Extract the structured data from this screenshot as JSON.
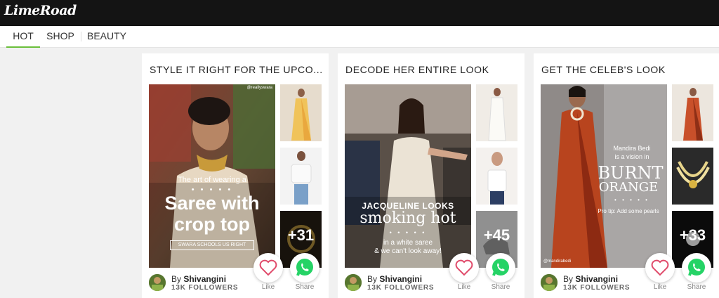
{
  "header": {
    "logo": "LimeRoad"
  },
  "nav": {
    "tabs": [
      {
        "label": "HOT"
      },
      {
        "label": "SHOP"
      },
      {
        "label": "BEAUTY"
      }
    ]
  },
  "colors": {
    "accent": "#6abf3b",
    "topbar": "#141414",
    "like": "#e04a6a",
    "whatsapp": "#25d366"
  },
  "cards": [
    {
      "title": "STYLE IT RIGHT FOR THE UPCO...",
      "overlay": {
        "small": "The art of wearing a",
        "big1": "Saree with",
        "big2": "crop top",
        "tag": "SWARA SCHOOLS US RIGHT",
        "handle": "@reallyswara"
      },
      "more": "+31",
      "author": {
        "by": "By",
        "name": "Shivangini",
        "followers": "13K FOLLOWERS"
      },
      "like_label": "Like",
      "share_label": "Share"
    },
    {
      "title": "DECODE HER ENTIRE LOOK",
      "overlay": {
        "line1": "JACQUELINE LOOKS",
        "line2": "smoking hot",
        "line3": "in a white saree",
        "line4": "& we can't look away!"
      },
      "more": "+45",
      "author": {
        "by": "By",
        "name": "Shivangini",
        "followers": "13K FOLLOWERS"
      },
      "like_label": "Like",
      "share_label": "Share"
    },
    {
      "title": "GET THE CELEB'S LOOK",
      "overlay": {
        "line1": "Mandira Bedi",
        "line2": "is a vision in",
        "big1": "BURNT",
        "big2": "ORANGE",
        "tip": "Pro tip: Add some pearls",
        "handle": "@mandirabedi"
      },
      "more": "+33",
      "author": {
        "by": "By",
        "name": "Shivangini",
        "followers": "13K FOLLOWERS"
      },
      "like_label": "Like",
      "share_label": "Share"
    }
  ]
}
